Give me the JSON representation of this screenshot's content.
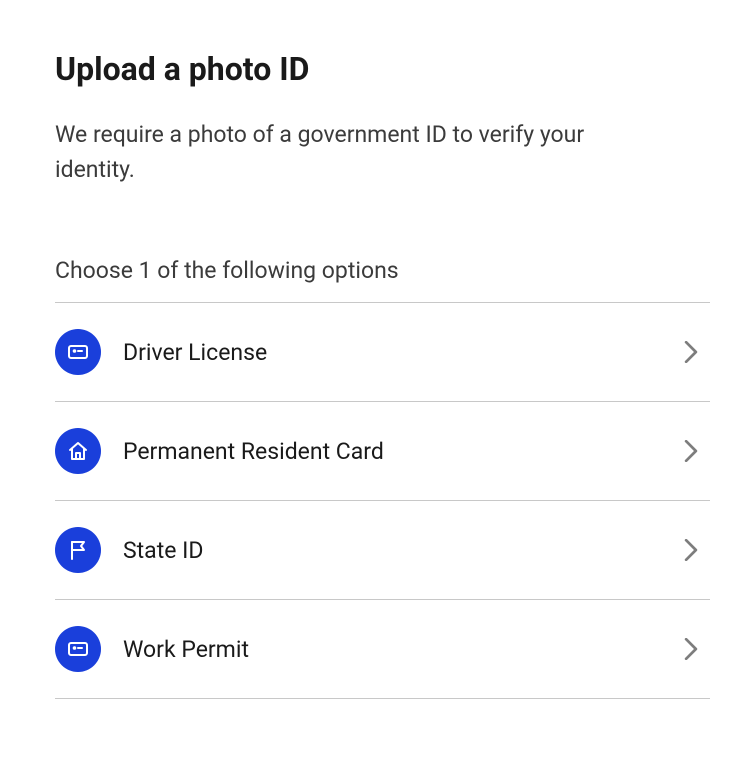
{
  "header": {
    "title": "Upload a photo ID",
    "description": "We require a photo of a government ID to verify your identity."
  },
  "section": {
    "label": "Choose 1 of the following options",
    "options": [
      {
        "label": "Driver License",
        "icon": "id-card-icon"
      },
      {
        "label": "Permanent Resident Card",
        "icon": "home-icon"
      },
      {
        "label": "State ID",
        "icon": "flag-icon"
      },
      {
        "label": "Work Permit",
        "icon": "id-card-icon"
      }
    ]
  },
  "colors": {
    "accent": "#1a3fdb"
  }
}
